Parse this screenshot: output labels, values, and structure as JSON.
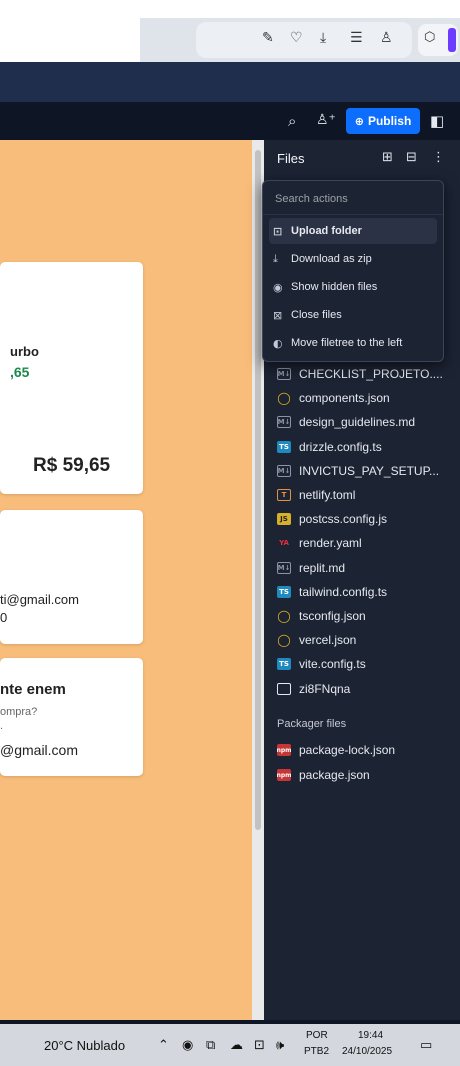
{
  "browser": {
    "icons": [
      "pen-icon",
      "heart-icon",
      "download-icon",
      "sliders-icon",
      "profile-icon"
    ],
    "extension_icon": "cube-icon"
  },
  "topbar": {
    "publish_label": "Publish",
    "icons": [
      "search-icon",
      "invite-user-icon",
      "panel-toggle-icon"
    ]
  },
  "preview": {
    "card1": {
      "title_fragment": "urbo",
      "price_fragment": ",65",
      "total": "R$ 59,65",
      "price_color": "#1a8a4a"
    },
    "card2": {
      "email_fragment": "ti@gmail.com",
      "line2_fragment": "0"
    },
    "card3": {
      "title_fragment": "nte enem",
      "subtitle_fragment": "ompra?",
      "line2_fragment": ".",
      "email_fragment": "@gmail.com"
    }
  },
  "files_panel": {
    "title": "Files",
    "icons": [
      "new-file-icon",
      "new-folder-icon",
      "more-icon"
    ]
  },
  "actions_menu": {
    "search_placeholder": "Search actions",
    "items": [
      {
        "label": "Upload folder",
        "icon": "upload-folder-icon"
      },
      {
        "label": "Download as zip",
        "icon": "download-icon"
      },
      {
        "label": "Show hidden files",
        "icon": "eye-icon"
      },
      {
        "label": "Close files",
        "icon": "close-files-icon"
      },
      {
        "label": "Move filetree to the left",
        "icon": "sidebar-icon"
      }
    ]
  },
  "files": [
    {
      "name": "CHECKLIST_PROJETO....",
      "type": "md"
    },
    {
      "name": "components.json",
      "type": "json"
    },
    {
      "name": "design_guidelines.md",
      "type": "md"
    },
    {
      "name": "drizzle.config.ts",
      "type": "ts"
    },
    {
      "name": "INVICTUS_PAY_SETUP...",
      "type": "md"
    },
    {
      "name": "netlify.toml",
      "type": "toml"
    },
    {
      "name": "postcss.config.js",
      "type": "js"
    },
    {
      "name": "render.yaml",
      "type": "yaml"
    },
    {
      "name": "replit.md",
      "type": "md"
    },
    {
      "name": "tailwind.config.ts",
      "type": "ts"
    },
    {
      "name": "tsconfig.json",
      "type": "json"
    },
    {
      "name": "vercel.json",
      "type": "json"
    },
    {
      "name": "vite.config.ts",
      "type": "ts"
    },
    {
      "name": "zi8FNqna",
      "type": "doc"
    }
  ],
  "packager": {
    "title": "Packager files",
    "files": [
      {
        "name": "package-lock.json",
        "type": "npm"
      },
      {
        "name": "package.json",
        "type": "npm"
      }
    ]
  },
  "taskbar": {
    "weather": "20°C  Nublado",
    "lang_top": "POR",
    "lang_bottom": "PTB2",
    "time": "19:44",
    "date": "24/10/2025"
  },
  "colors": {
    "publish": "#0d6efd",
    "preview_bg": "#f8bd7a",
    "panel_bg": "#1c2333"
  }
}
